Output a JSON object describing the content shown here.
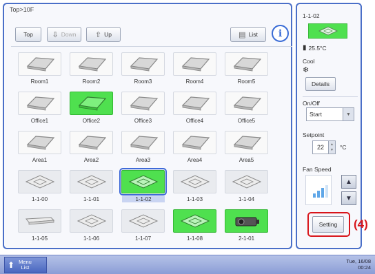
{
  "breadcrumb": "Top>10F",
  "toolbar": {
    "top_label": "Top",
    "down_label": "Down",
    "up_label": "Up",
    "list_label": "List",
    "info_icon": "info-icon"
  },
  "grid": {
    "rows": [
      [
        {
          "label": "Room1",
          "kind": "area",
          "on": false
        },
        {
          "label": "Room2",
          "kind": "area",
          "on": false
        },
        {
          "label": "Room3",
          "kind": "area",
          "on": false
        },
        {
          "label": "Room4",
          "kind": "area",
          "on": false
        },
        {
          "label": "Room5",
          "kind": "area",
          "on": false
        }
      ],
      [
        {
          "label": "Office1",
          "kind": "area",
          "on": false
        },
        {
          "label": "Office2",
          "kind": "area",
          "on": true
        },
        {
          "label": "Office3",
          "kind": "area",
          "on": false
        },
        {
          "label": "Office4",
          "kind": "area",
          "on": false
        },
        {
          "label": "Office5",
          "kind": "area",
          "on": false
        }
      ],
      [
        {
          "label": "Area1",
          "kind": "area",
          "on": false
        },
        {
          "label": "Area2",
          "kind": "area",
          "on": false
        },
        {
          "label": "Area3",
          "kind": "area",
          "on": false
        },
        {
          "label": "Area4",
          "kind": "area",
          "on": false
        },
        {
          "label": "Area5",
          "kind": "area",
          "on": false
        }
      ],
      [
        {
          "label": "1-1-00",
          "kind": "cassette",
          "on": false
        },
        {
          "label": "1-1-01",
          "kind": "cassette",
          "on": false
        },
        {
          "label": "1-1-02",
          "kind": "cassette",
          "on": true,
          "selected": true
        },
        {
          "label": "1-1-03",
          "kind": "cassette",
          "on": false
        },
        {
          "label": "1-1-04",
          "kind": "cassette",
          "on": false
        }
      ],
      [
        {
          "label": "1-1-05",
          "kind": "ceiling",
          "on": false
        },
        {
          "label": "1-1-06",
          "kind": "cassette",
          "on": false
        },
        {
          "label": "1-1-07",
          "kind": "cassette",
          "on": false
        },
        {
          "label": "1-1-08",
          "kind": "cassette",
          "on": true
        },
        {
          "label": "2-1-01",
          "kind": "projector",
          "on": true
        }
      ]
    ]
  },
  "side": {
    "unit_name": "1-1-02",
    "temperature": "25.5°C",
    "mode": "Cool",
    "details_label": "Details",
    "onoff_label": "On/Off",
    "onoff_value": "Start",
    "setpoint_label": "Setpoint",
    "setpoint_value": "22",
    "setpoint_unit": "°C",
    "fan_speed_label": "Fan Speed",
    "setting_label": "Setting"
  },
  "annotation": "(4)",
  "bottom": {
    "menu_line1": "Menu",
    "menu_line2": "List",
    "date": "Tue, 16/08",
    "time": "00:24"
  },
  "colors": {
    "accent": "#4a6fc8",
    "on_green": "#4fe04f",
    "highlight_red": "#d8141a"
  }
}
